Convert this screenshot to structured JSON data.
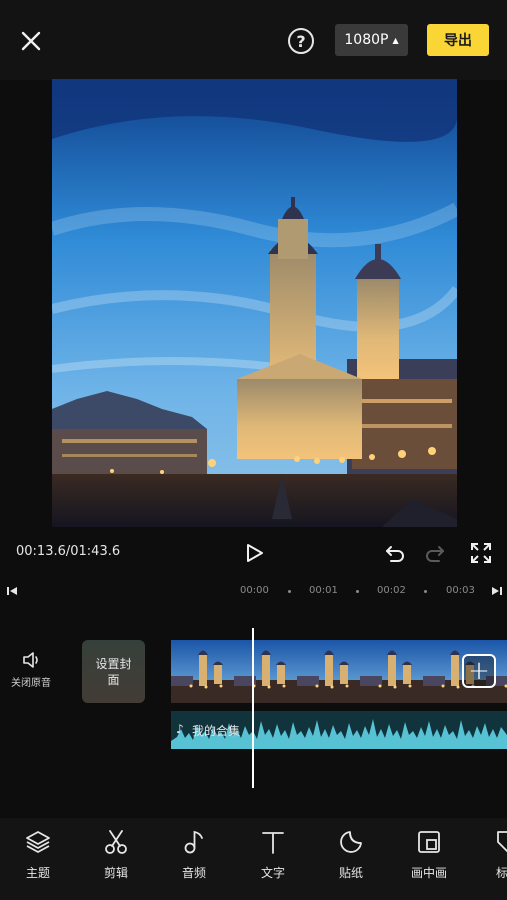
{
  "header": {
    "resolution_label": "1080P",
    "export_label": "导出",
    "help_glyph": "?"
  },
  "playback": {
    "time_readout": "00:13.6/01:43.6"
  },
  "ruler": {
    "ticks": [
      "00:00",
      "00:01",
      "00:02",
      "00:03"
    ]
  },
  "tracks": {
    "mute_label": "关闭原音",
    "cover_label": "设置封面",
    "add_glyph": "+",
    "audio_label": "我的合集"
  },
  "toolbar": {
    "items": [
      {
        "label": "主题",
        "icon": "layers-icon"
      },
      {
        "label": "剪辑",
        "icon": "scissors-icon"
      },
      {
        "label": "音频",
        "icon": "music-note-icon"
      },
      {
        "label": "文字",
        "icon": "text-icon"
      },
      {
        "label": "贴纸",
        "icon": "sticker-icon"
      },
      {
        "label": "画中画",
        "icon": "picture-in-picture-icon"
      },
      {
        "label": "标",
        "icon": "tag-icon"
      }
    ]
  },
  "colors": {
    "accent": "#f9d535",
    "background": "#0d0d0d",
    "audio_wave": "#57c2d4"
  }
}
